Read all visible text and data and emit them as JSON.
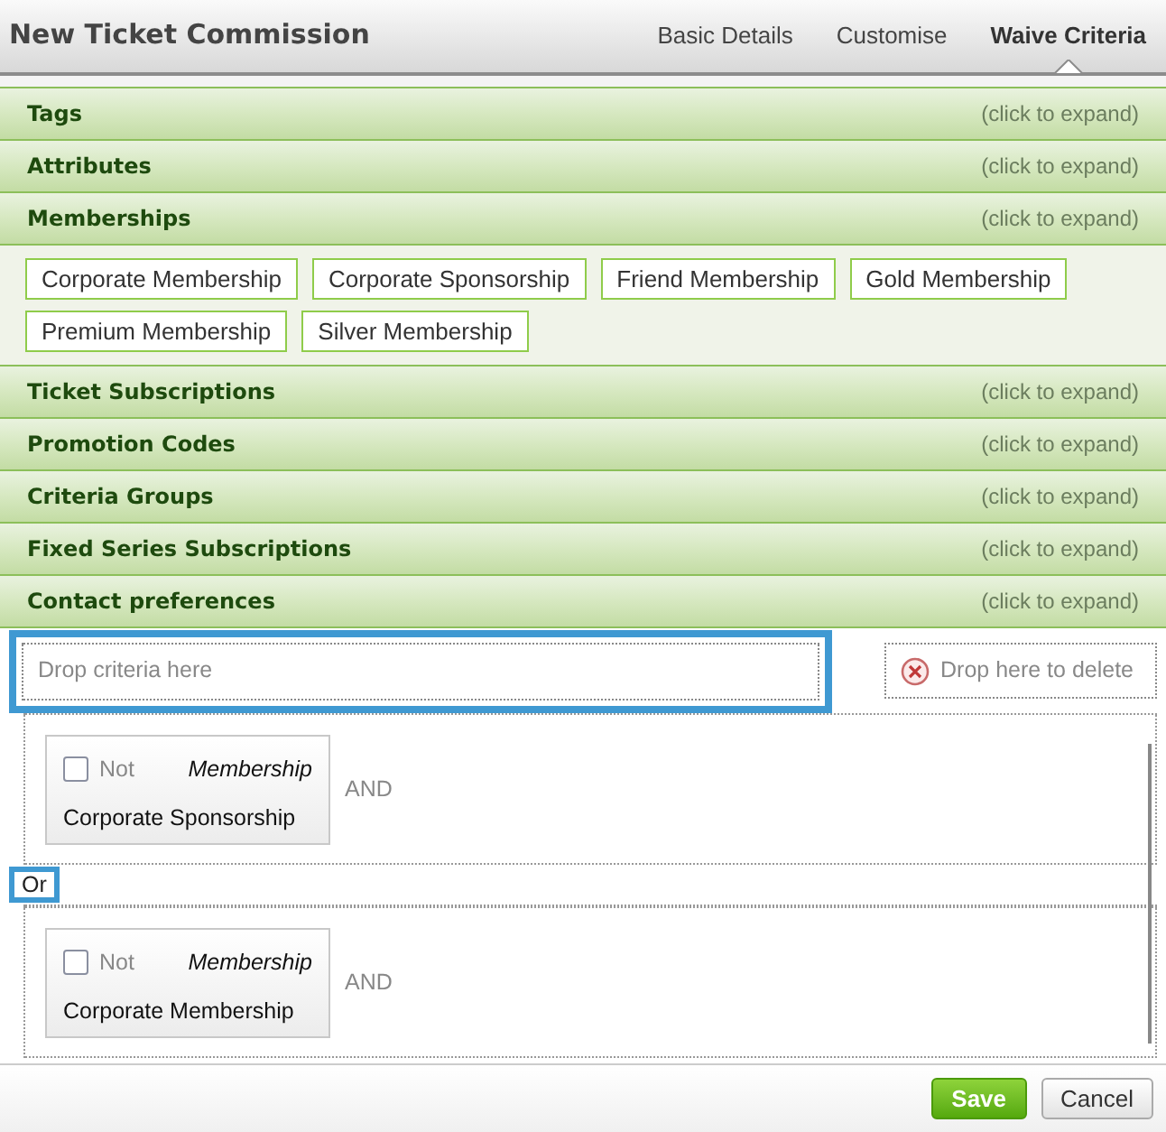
{
  "window": {
    "title": "New Ticket Commission"
  },
  "tabs": [
    {
      "label": "Basic Details",
      "selected": false
    },
    {
      "label": "Customise",
      "selected": false
    },
    {
      "label": "Waive Criteria",
      "selected": true
    }
  ],
  "sections": [
    {
      "title": "Tags",
      "hint": "(click to expand)"
    },
    {
      "title": "Attributes",
      "hint": "(click to expand)"
    },
    {
      "title": "Memberships",
      "hint": "(click to expand)",
      "items": [
        "Corporate Membership",
        "Corporate Sponsorship",
        "Friend Membership",
        "Gold Membership",
        "Premium Membership",
        "Silver Membership"
      ]
    },
    {
      "title": "Ticket Subscriptions",
      "hint": "(click to expand)"
    },
    {
      "title": "Promotion Codes",
      "hint": "(click to expand)"
    },
    {
      "title": "Criteria Groups",
      "hint": "(click to expand)"
    },
    {
      "title": "Fixed Series Subscriptions",
      "hint": "(click to expand)"
    },
    {
      "title": "Contact preferences",
      "hint": "(click to expand)"
    }
  ],
  "drop_zone": {
    "placeholder": "Drop criteria here"
  },
  "delete_zone": {
    "label": "Drop here to delete"
  },
  "groups": [
    {
      "criteria": [
        {
          "not_label": "Not",
          "not_checked": false,
          "type": "Membership",
          "value": "Corporate Sponsorship"
        }
      ],
      "joiner": "AND"
    },
    {
      "criteria": [
        {
          "not_label": "Not",
          "not_checked": false,
          "type": "Membership",
          "value": "Corporate Membership"
        }
      ],
      "joiner": "AND"
    }
  ],
  "or_label": "Or",
  "buttons": {
    "save": "Save",
    "cancel": "Cancel"
  }
}
